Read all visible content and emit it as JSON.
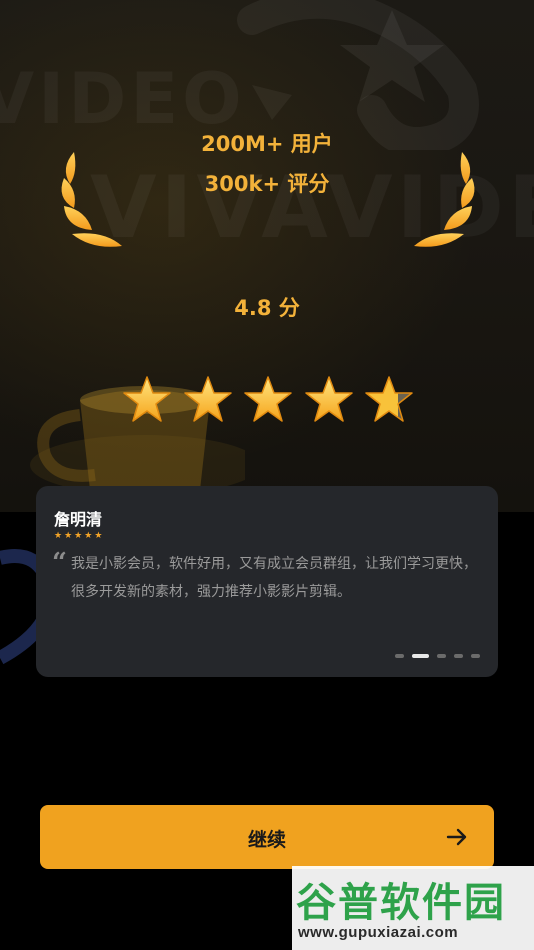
{
  "hero": {
    "watermark_text_1": "VIDEO",
    "watermark_text_2": "VIVAVIDEO",
    "users": "200M+ 用户",
    "ratings": "300k+ 评分",
    "score": "4.8 分",
    "rating_stars": 5
  },
  "review_card": {
    "reviewer_name": "詹明清",
    "reviewer_rating": 5,
    "quote_mark": "“",
    "review_text": "我是小影会员，软件好用，又有成立会员群组，让我们学习更快，很多开发新的素材，强力推荐小影影片剪辑。",
    "pagination": {
      "count": 5,
      "active_index": 1
    }
  },
  "continue_button": {
    "label": "继续",
    "icon": "arrow-right-icon"
  },
  "watermark": {
    "logo_text": "谷普软件园",
    "url": "www.gupuxiazai.com"
  },
  "colors": {
    "accent": "#f0a21f",
    "gold_text": "#f3b23a",
    "card_bg": "#25272b"
  }
}
